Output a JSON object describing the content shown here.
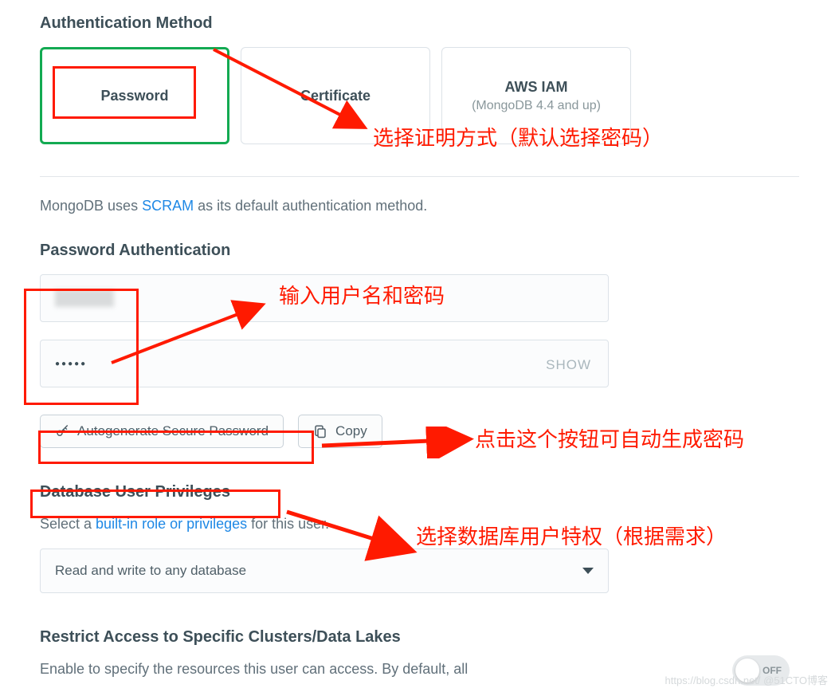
{
  "auth_method": {
    "title": "Authentication Method",
    "cards": [
      {
        "label": "Password",
        "sub": ""
      },
      {
        "label": "Certificate",
        "sub": ""
      },
      {
        "label": "AWS IAM",
        "sub": "(MongoDB 4.4 and up)"
      }
    ]
  },
  "info_line": {
    "prefix": "MongoDB uses ",
    "link": "SCRAM",
    "suffix": " as its default authentication method."
  },
  "password_auth": {
    "title": "Password Authentication",
    "password_masked": "●●●●●",
    "show": "SHOW",
    "autogen": "Autogenerate Secure Password",
    "copy": "Copy"
  },
  "privileges": {
    "title": "Database User Privileges",
    "select_prefix": "Select a ",
    "select_link": "built-in role or privileges",
    "select_suffix": " for this user.",
    "selected": "Read and write to any database"
  },
  "restrict": {
    "title": "Restrict Access to Specific Clusters/Data Lakes",
    "desc": "Enable to specify the resources this user can access. By default, all",
    "toggle": "OFF"
  },
  "annotations": {
    "a1": "选择证明方式（默认选择密码）",
    "a2": "输入用户名和密码",
    "a3": "点击这个按钮可自动生成密码",
    "a4": "选择数据库用户特权（根据需求）"
  },
  "watermark": "https://blog.csdn.net/  @51CTO博客"
}
